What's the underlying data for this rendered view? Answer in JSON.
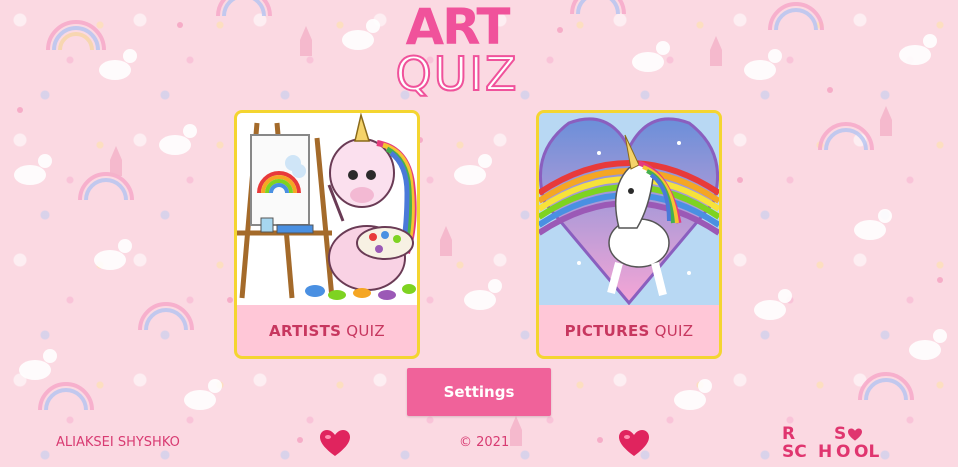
{
  "logo": {
    "line1": "ART",
    "line2": "QUIZ"
  },
  "cards": [
    {
      "strong": "ARTISTS",
      "rest": "QUIZ"
    },
    {
      "strong": "PICTURES",
      "rest": "QUIZ"
    }
  ],
  "settings_label": "Settings",
  "footer": {
    "author": "ALIAKSEI SHYSHKO",
    "copyright": "© 2021",
    "school_logo": {
      "letters": [
        "R",
        "S",
        "SC",
        "H",
        "O",
        "OL"
      ]
    }
  },
  "colors": {
    "accent": "#f0529b",
    "card_border": "#f4d530",
    "card_label_bg": "#ffc7d7",
    "background": "#fbd9e2"
  },
  "icons": [
    "heart-icon",
    "rs-school-logo"
  ]
}
